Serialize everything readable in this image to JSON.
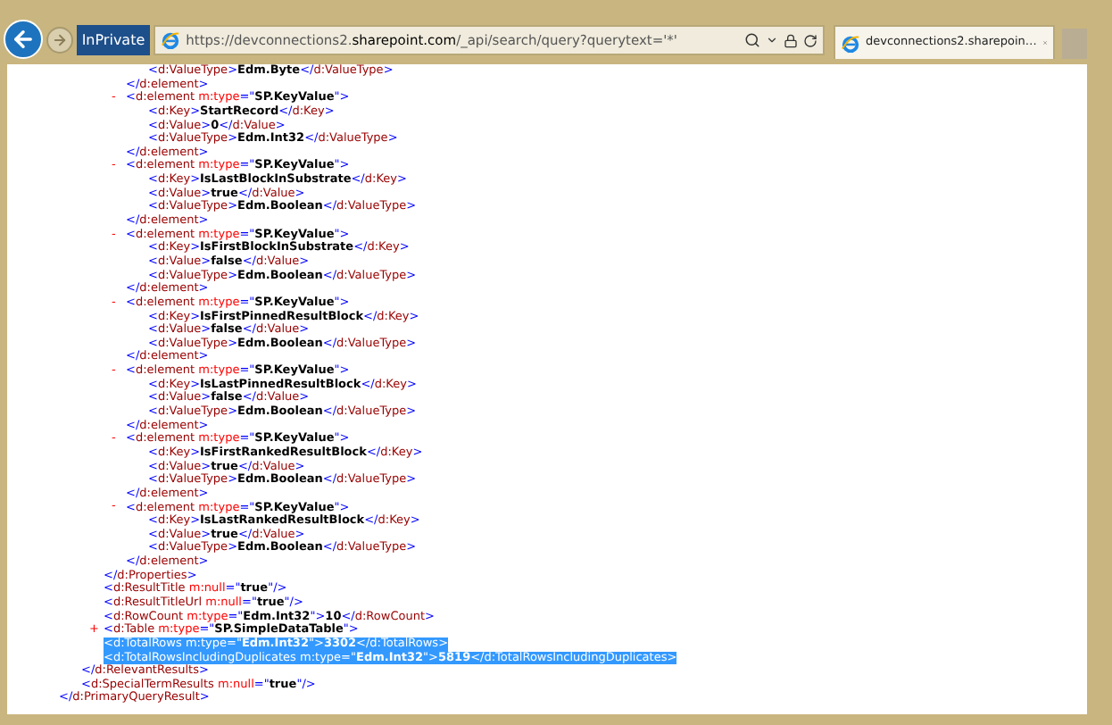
{
  "toolbar": {
    "private_badge": "InPrivate",
    "url": "https://devconnections2.**sharepoint.com**/_api/search/query?querytext='*'",
    "tab": {
      "title": "devconnections2.sharepoin…",
      "selected": true
    }
  },
  "document": {
    "nodes": [
      {
        "close": "</d:PrimaryQueryResult>",
        "children": [
          {
            "close": "</d:RelevantResults>",
            "children": [
              {
                "close": "</d:Properties>",
                "children": [
                  {
                    "close": "</d:element>",
                    "children": [
                      {
                        "line": "<d:ValueType>Edm.Byte</d:ValueType>",
                        "selected": false
                      }
                    ]
                  },
                  {
                    "toggle": "-",
                    "open": "<d:element m:type=\"SP.KeyValue\">",
                    "close": "</d:element>",
                    "children": [
                      {
                        "line": "<d:Key>StartRecord</d:Key>",
                        "selected": false
                      },
                      {
                        "line": "<d:Value>0</d:Value>",
                        "selected": false
                      },
                      {
                        "line": "<d:ValueType>Edm.Int32</d:ValueType>",
                        "selected": false
                      }
                    ]
                  },
                  {
                    "toggle": "-",
                    "open": "<d:element m:type=\"SP.KeyValue\">",
                    "close": "</d:element>",
                    "children": [
                      {
                        "line": "<d:Key>IsLastBlockInSubstrate</d:Key>",
                        "selected": false
                      },
                      {
                        "line": "<d:Value>true</d:Value>",
                        "selected": false
                      },
                      {
                        "line": "<d:ValueType>Edm.Boolean</d:ValueType>",
                        "selected": false
                      }
                    ]
                  },
                  {
                    "toggle": "-",
                    "open": "<d:element m:type=\"SP.KeyValue\">",
                    "close": "</d:element>",
                    "children": [
                      {
                        "line": "<d:Key>IsFirstBlockInSubstrate</d:Key>",
                        "selected": false
                      },
                      {
                        "line": "<d:Value>false</d:Value>",
                        "selected": false
                      },
                      {
                        "line": "<d:ValueType>Edm.Boolean</d:ValueType>",
                        "selected": false
                      }
                    ]
                  },
                  {
                    "toggle": "-",
                    "open": "<d:element m:type=\"SP.KeyValue\">",
                    "close": "</d:element>",
                    "children": [
                      {
                        "line": "<d:Key>IsFirstPinnedResultBlock</d:Key>",
                        "selected": false
                      },
                      {
                        "line": "<d:Value>false</d:Value>",
                        "selected": false
                      },
                      {
                        "line": "<d:ValueType>Edm.Boolean</d:ValueType>",
                        "selected": false
                      }
                    ]
                  },
                  {
                    "toggle": "-",
                    "open": "<d:element m:type=\"SP.KeyValue\">",
                    "close": "</d:element>",
                    "children": [
                      {
                        "line": "<d:Key>IsLastPinnedResultBlock</d:Key>",
                        "selected": false
                      },
                      {
                        "line": "<d:Value>false</d:Value>",
                        "selected": false
                      },
                      {
                        "line": "<d:ValueType>Edm.Boolean</d:ValueType>",
                        "selected": false
                      }
                    ]
                  },
                  {
                    "toggle": "-",
                    "open": "<d:element m:type=\"SP.KeyValue\">",
                    "close": "</d:element>",
                    "children": [
                      {
                        "line": "<d:Key>IsFirstRankedResultBlock</d:Key>",
                        "selected": false
                      },
                      {
                        "line": "<d:Value>true</d:Value>",
                        "selected": false
                      },
                      {
                        "line": "<d:ValueType>Edm.Boolean</d:ValueType>",
                        "selected": false
                      }
                    ]
                  },
                  {
                    "toggle": "-",
                    "open": "<d:element m:type=\"SP.KeyValue\">",
                    "close": "</d:element>",
                    "children": [
                      {
                        "line": "<d:Key>IsLastRankedResultBlock</d:Key>",
                        "selected": false
                      },
                      {
                        "line": "<d:Value>true</d:Value>",
                        "selected": false
                      },
                      {
                        "line": "<d:ValueType>Edm.Boolean</d:ValueType>",
                        "selected": false
                      }
                    ]
                  }
                ]
              },
              {
                "line": "<d:ResultTitle m:null=\"true\"/>",
                "selected": false
              },
              {
                "line": "<d:ResultTitleUrl m:null=\"true\"/>",
                "selected": false
              },
              {
                "line": "<d:RowCount m:type=\"Edm.Int32\">10</d:RowCount>",
                "selected": false
              },
              {
                "toggle": "+",
                "line": "<d:Table m:type=\"SP.SimpleDataTable\">",
                "selected": false
              },
              {
                "line": "<d:TotalRows m:type=\"Edm.Int32\">3302</d:TotalRows>",
                "selected": true
              },
              {
                "line": "<d:TotalRowsIncludingDuplicates m:type=\"Edm.Int32\">5819</d:TotalRowsIncludingDuplicates>",
                "selected": true
              }
            ]
          },
          {
            "line": "<d:SpecialTermResults m:null=\"true\"/>",
            "selected": false
          }
        ]
      }
    ]
  }
}
